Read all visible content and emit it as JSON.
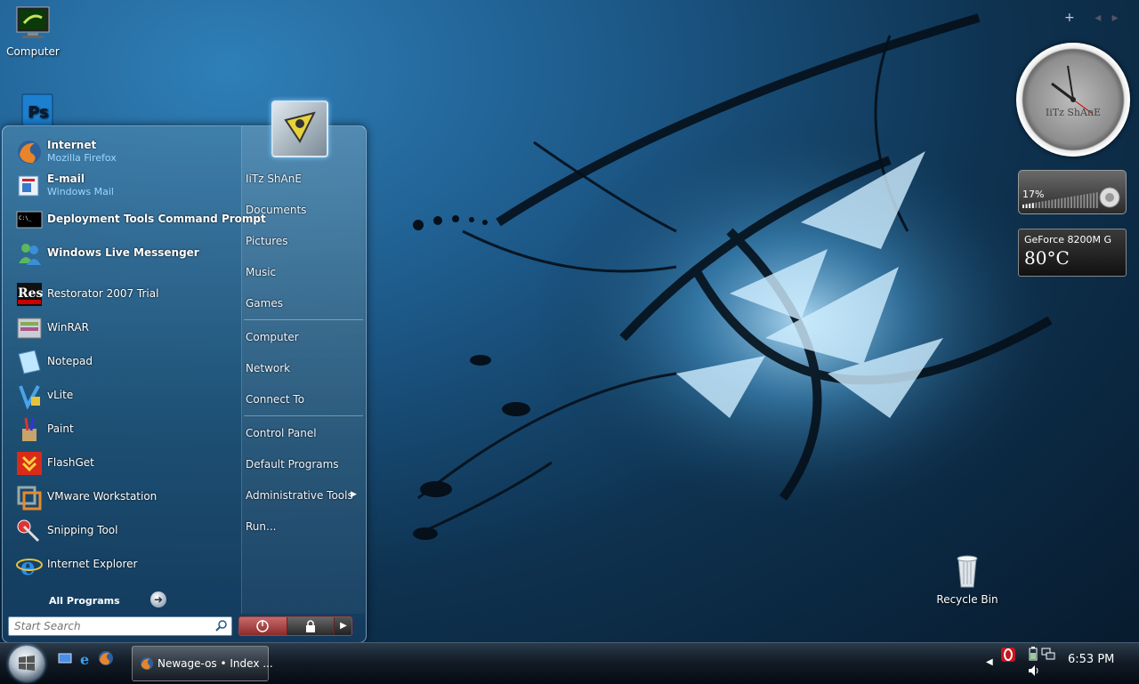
{
  "desktop": {
    "icons": [
      {
        "label": "Computer"
      },
      {
        "label": ""
      },
      {
        "label": "Recycle Bin"
      }
    ]
  },
  "start_menu": {
    "pinned": [
      {
        "name": "Internet",
        "sub": "Mozilla Firefox"
      },
      {
        "name": "E-mail",
        "sub": "Windows Mail"
      }
    ],
    "programs": [
      {
        "name": "Deployment Tools Command Prompt",
        "bold": true
      },
      {
        "name": "Windows Live Messenger",
        "bold": true
      },
      {
        "name": "Restorator 2007 Trial"
      },
      {
        "name": "WinRAR"
      },
      {
        "name": "Notepad"
      },
      {
        "name": "vLite"
      },
      {
        "name": "Paint"
      },
      {
        "name": "FlashGet"
      },
      {
        "name": "VMware Workstation"
      },
      {
        "name": "Snipping Tool"
      },
      {
        "name": "Internet Explorer"
      }
    ],
    "all_programs": "All Programs",
    "search_placeholder": "Start Search",
    "right_links": [
      "IiTz ShAnE",
      "Documents",
      "Pictures",
      "Music",
      "Games",
      "Computer",
      "Network",
      "Connect To",
      "Control Panel",
      "Default Programs",
      "Administrative Tools",
      "Run..."
    ]
  },
  "gadgets": {
    "clock_label": "IiTz ShAnE",
    "volume_percent": "17%",
    "volume_level": 0.17,
    "gpu_name": "GeForce 8200M G",
    "gpu_temp": "80°C"
  },
  "taskbar": {
    "task_label": "Newage-os • Index ...",
    "clock": "6:53 PM"
  }
}
